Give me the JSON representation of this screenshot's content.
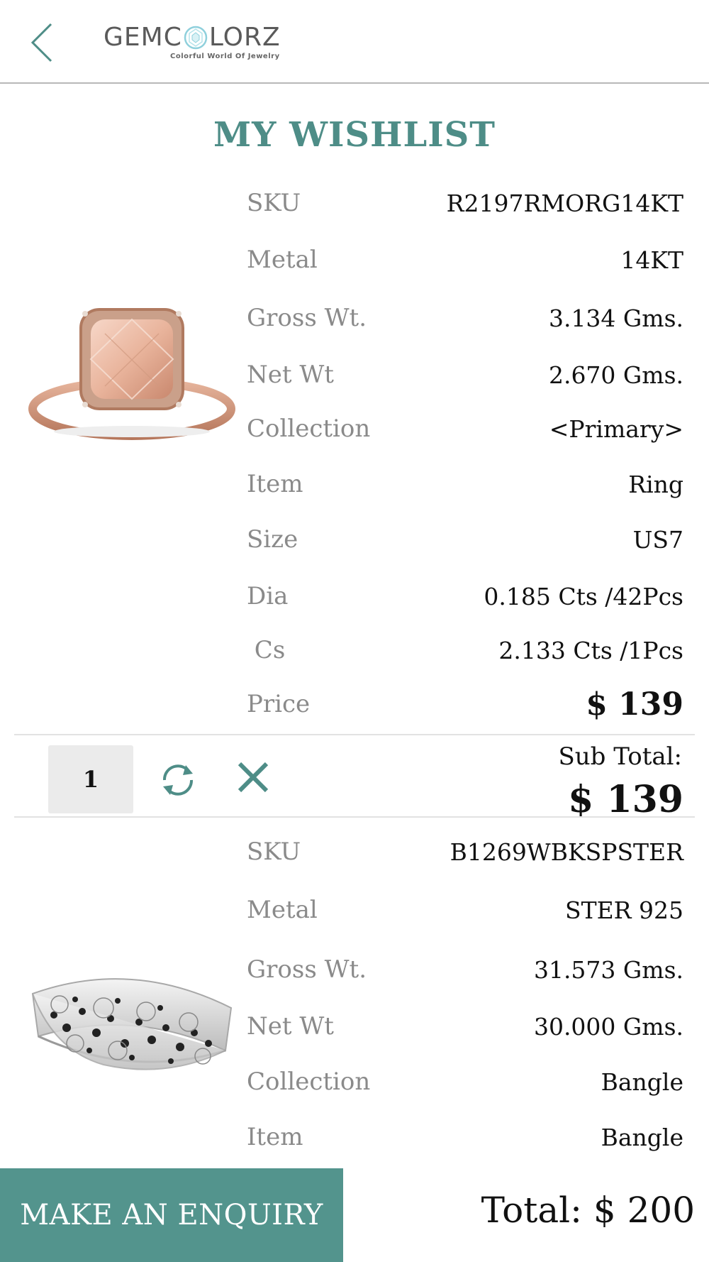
{
  "header": {
    "back_icon": "chevron-left-icon",
    "logo_text_left": "GEMC",
    "logo_text_right": "LORZ",
    "logo_tagline": "Colorful World Of Jewelry"
  },
  "page_title": "MY WISHLIST",
  "items": [
    {
      "image": "rose-gold-morganite-ring",
      "specs": [
        {
          "label": "SKU",
          "value": "R2197RMORG14KT"
        },
        {
          "label": "Metal",
          "value": "14KT"
        },
        {
          "label": "Gross Wt.",
          "value": "3.134 Gms."
        },
        {
          "label": "Net Wt",
          "value": "2.670 Gms."
        },
        {
          "label": "Collection",
          "value": "<Primary>"
        },
        {
          "label": "Item",
          "value": "Ring"
        },
        {
          "label": "Size",
          "value": "US7"
        },
        {
          "label": "Dia",
          "value": "0.185 Cts /42Pcs"
        },
        {
          "label": " Cs",
          "value": "2.133 Cts /1Pcs"
        },
        {
          "label": "Price",
          "value": "$ 139"
        }
      ],
      "quantity": "1",
      "subtotal_label": "Sub Total:",
      "subtotal_value": "$ 139"
    },
    {
      "image": "silver-black-spinel-bangle",
      "specs": [
        {
          "label": "SKU",
          "value": "B1269WBKSPSTER"
        },
        {
          "label": "Metal",
          "value": "STER 925"
        },
        {
          "label": "Gross Wt.",
          "value": "31.573 Gms."
        },
        {
          "label": "Net Wt",
          "value": "30.000 Gms."
        },
        {
          "label": "Collection",
          "value": "Bangle"
        },
        {
          "label": "Item",
          "value": "Bangle"
        }
      ]
    }
  ],
  "controls": {
    "refresh_icon": "refresh-icon",
    "remove_icon": "close-icon"
  },
  "footer": {
    "enquiry_label": "MAKE AN ENQUIRY",
    "total": "Total: $ 200"
  },
  "colors": {
    "accent": "#4e8d87",
    "button": "#53948d",
    "label_gray": "#8a8a8a"
  }
}
